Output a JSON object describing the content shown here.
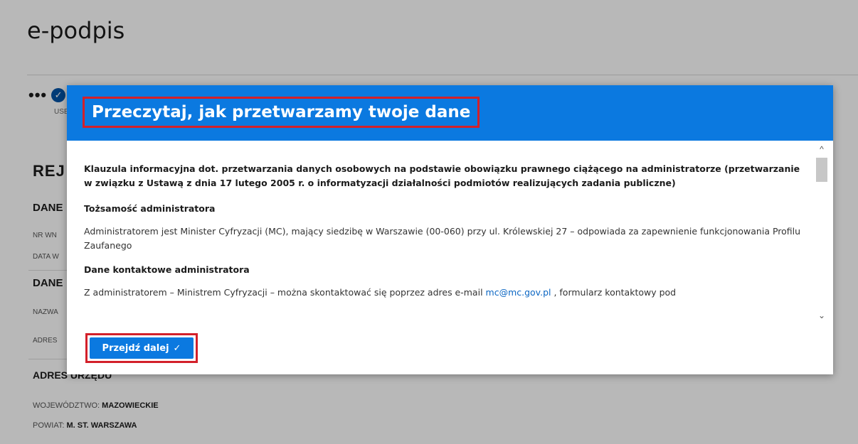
{
  "app": {
    "title": "e-podpis"
  },
  "steps": {
    "dots": "•••",
    "check": "✓",
    "label": "USE"
  },
  "background": {
    "section_title": "REJ",
    "group1_title": "DANE",
    "field_nr": "NR WN",
    "field_date": "DATA W",
    "group2_title": "DANE",
    "field_name": "NAZWA",
    "field_address": "ADRES",
    "office_title": "ADRES URZĘDU",
    "voivodeship_label": "WOJEWÓDZTWO:",
    "voivodeship_value": "MAZOWIECKIE",
    "county_label": "POWIAT:",
    "county_value": "M. ST. WARSZAWA"
  },
  "modal": {
    "title": "Przeczytaj, jak przetwarzamy twoje dane",
    "clause": "Klauzula informacyjna dot. przetwarzania danych osobowych na podstawie obowiązku prawnego ciążącego na administratorze (przetwarzanie w związku z Ustawą z dnia 17 lutego 2005 r. o informatyzacji działalności podmiotów realizujących zadania publiczne)",
    "section1_title": "Tożsamość administratora",
    "section1_text": "Administratorem jest Minister Cyfryzacji (MC), mający siedzibę w Warszawie (00-060) przy ul. Królewskiej 27 – odpowiada za zapewnienie funkcjonowania Profilu Zaufanego",
    "section2_title": "Dane kontaktowe administratora",
    "section2_text_before": "Z administratorem – Ministrem Cyfryzacji – można skontaktować się poprzez adres e-mail ",
    "section2_email": "mc@mc.gov.pl",
    "section2_text_after": " , formularz kontaktowy pod",
    "button_label": "Przejdź dalej",
    "button_icon": "✓",
    "scroll_up": "^",
    "scroll_down": "⌄"
  }
}
